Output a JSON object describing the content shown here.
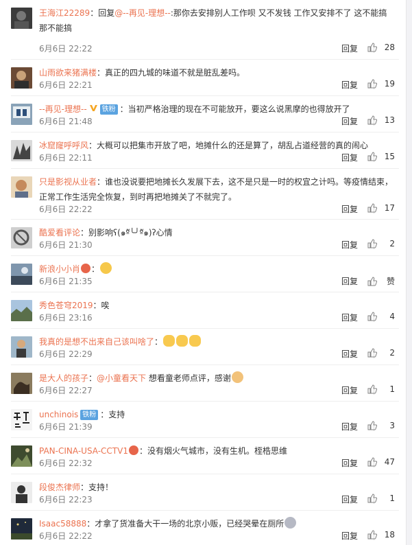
{
  "colors": {
    "username": "#eb7350",
    "text": "#333333",
    "meta": "#808080",
    "badge": "#5ba3e0"
  },
  "comments": [
    {
      "username": "王海江22289",
      "parts": {
        "pre": "回复",
        "mention": "@--再见-理想--",
        "body": ":那你去安排别人工作呗 又不发钱 工作又安排不了 这不能搞那不能搞"
      },
      "time": "6月6日 22:22",
      "reply": "回复",
      "likes": "28"
    },
    {
      "username": "山雨欲来猪满楼",
      "parts": {
        "body": "：真正的四九城的味道不就是脏乱差吗。"
      },
      "time": "6月6日 22:21",
      "reply": "回复",
      "likes": "19"
    },
    {
      "username": "--再见-理想--",
      "badge": "铁粉",
      "parts": {
        "body": "：当初严格治理的现在不可能放开，要这么说黑摩的也得放开了"
      },
      "time": "6月6日 21:48",
      "reply": "回复",
      "likes": "13"
    },
    {
      "username": "冰窟窿呼呼风",
      "parts": {
        "body": "：大概可以把集市开放了吧，地摊什么的还是算了，胡乱占道经营的真的闹心"
      },
      "time": "6月6日 22:11",
      "reply": "回复",
      "likes": "15"
    },
    {
      "username": "只是影视从业者",
      "parts": {
        "body": "：谁也没说要把地摊长久发展下去，这不是只是一时的权宜之计吗。等疫情结束，正常工作生活完全恢复，到时再把地摊关了不就完了。"
      },
      "time": "6月6日 22:22",
      "reply": "回复",
      "likes": "17"
    },
    {
      "username": "酷爱看评论",
      "parts": {
        "body": "：别影响ʕ(๑ºั╰╯ºั๑)ʔ心情"
      },
      "time": "6月6日 21:30",
      "reply": "回复",
      "likes": "2"
    },
    {
      "username": "新浪小小肖",
      "parts": {
        "body": "："
      },
      "time": "6月6日 21:35",
      "reply": "回复",
      "likes": "赞"
    },
    {
      "username": "秀色苍穹2019",
      "parts": {
        "body": "：唉"
      },
      "time": "6月6日 23:16",
      "reply": "回复",
      "likes": "4"
    },
    {
      "username": "我真的是想不出来自己该叫啥了",
      "parts": {
        "body": "："
      },
      "time": "6月6日 22:29",
      "reply": "回复",
      "likes": "2"
    },
    {
      "username": "是大人的孩子",
      "parts": {
        "body": "：",
        "mention": "@小童看天下",
        "body2": " 想看童老师点评，感谢"
      },
      "time": "6月6日 22:27",
      "reply": "回复",
      "likes": "1"
    },
    {
      "username": "unchinois",
      "badge": "铁粉",
      "parts": {
        "body": "：支持"
      },
      "time": "6月6日 21:39",
      "reply": "回复",
      "likes": "3"
    },
    {
      "username": "PAN-CINA-USA-CCTV1",
      "parts": {
        "body": "：没有烟火气城市，没有生机。桎梏思维"
      },
      "time": "6月6日 22:32",
      "reply": "回复",
      "likes": "47"
    },
    {
      "username": "段俊杰律师",
      "parts": {
        "body": "：支持！"
      },
      "time": "6月6日 22:23",
      "reply": "回复",
      "likes": "1"
    },
    {
      "username": "Isaac58888",
      "parts": {
        "body": "：才拿了货准备大干一场的北京小贩，已经哭晕在厕所"
      },
      "time": "6月6日 22:22",
      "reply": "回复",
      "likes": "18"
    }
  ]
}
